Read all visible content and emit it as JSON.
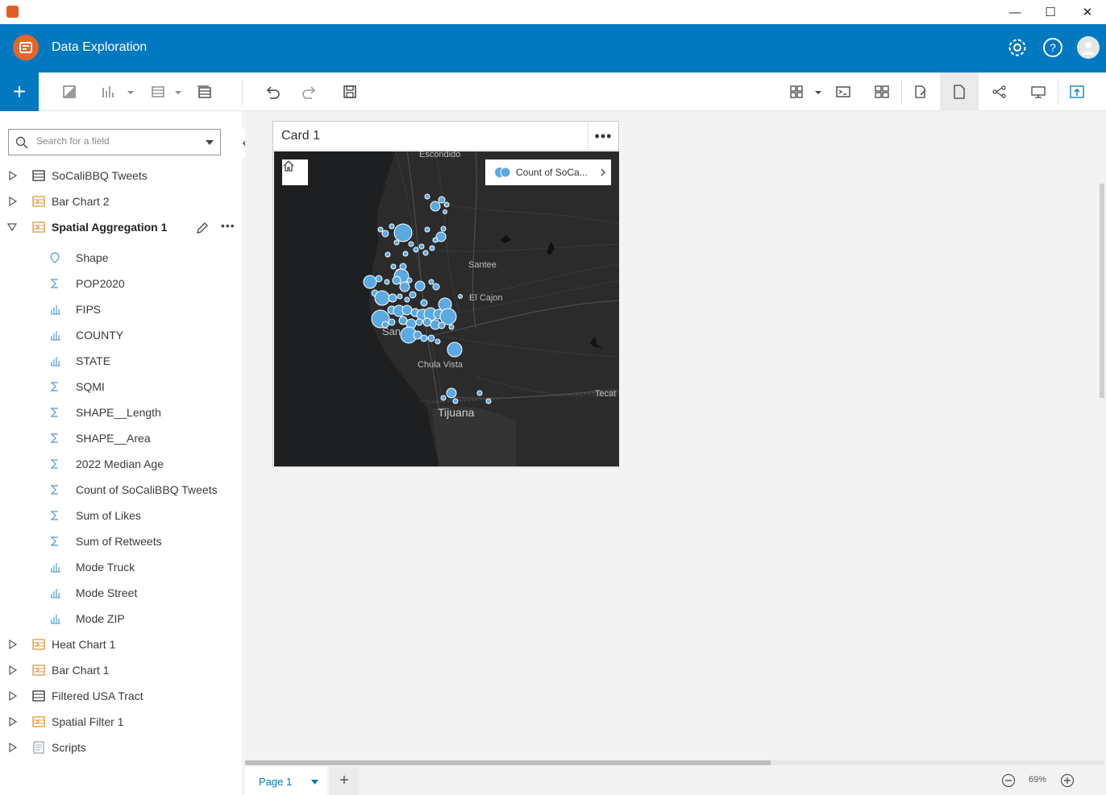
{
  "app": {
    "title": "Data Exploration",
    "window_controls": {
      "minimize": "—",
      "maximize": "☐",
      "close": "✕"
    }
  },
  "sidebar": {
    "search_placeholder": "Search for a field",
    "datasets": [
      {
        "label": "SoCaliBBQ Tweets",
        "icon": "table-icon",
        "expanded": false
      },
      {
        "label": "Bar Chart 2",
        "icon": "result-dataset-icon",
        "expanded": false
      },
      {
        "label": "Spatial Aggregation 1",
        "icon": "result-dataset-icon",
        "expanded": true
      }
    ],
    "fields": [
      {
        "label": "Shape",
        "icon": "location-field-icon"
      },
      {
        "label": "POP2020",
        "icon": "sum-field-icon"
      },
      {
        "label": "FIPS",
        "icon": "string-field-icon"
      },
      {
        "label": "COUNTY",
        "icon": "string-field-icon"
      },
      {
        "label": "STATE",
        "icon": "string-field-icon"
      },
      {
        "label": "SQMI",
        "icon": "sum-field-icon"
      },
      {
        "label": "SHAPE__Length",
        "icon": "sum-field-icon"
      },
      {
        "label": "SHAPE__Area",
        "icon": "sum-field-icon"
      },
      {
        "label": "2022 Median Age",
        "icon": "sum-field-icon"
      },
      {
        "label": "Count of SoCaliBBQ Tweets",
        "icon": "sum-field-icon"
      },
      {
        "label": "Sum of Likes",
        "icon": "sum-field-icon"
      },
      {
        "label": "Sum of Retweets",
        "icon": "sum-field-icon"
      },
      {
        "label": "Mode Truck",
        "icon": "string-field-icon"
      },
      {
        "label": "Mode Street",
        "icon": "string-field-icon"
      },
      {
        "label": "Mode ZIP",
        "icon": "string-field-icon"
      }
    ],
    "more_datasets": [
      {
        "label": "Heat Chart 1",
        "icon": "result-dataset-icon"
      },
      {
        "label": "Bar Chart 1",
        "icon": "result-dataset-icon"
      },
      {
        "label": "Filtered USA Tract",
        "icon": "table-icon"
      },
      {
        "label": "Spatial Filter 1",
        "icon": "result-dataset-icon"
      },
      {
        "label": "Scripts",
        "icon": "scripts-icon"
      }
    ]
  },
  "card": {
    "title": "Card 1",
    "menu": "•••",
    "legend_label": "Count of SoCa...",
    "places": {
      "escondido": "Escondido",
      "santee": "Santee",
      "el_cajon": "El Cajon",
      "san": "San",
      "chula_vista": "Chula Vista",
      "tecate": "Tecat",
      "tijuana": "Tijuana"
    }
  },
  "footer": {
    "page_label": "Page 1",
    "zoom_text": "69%"
  },
  "colors": {
    "brand_blue": "#0079c1",
    "map_bg": "#2b2b2b",
    "bubble": "#5aa9e0",
    "logo_orange": "#e8652b"
  }
}
